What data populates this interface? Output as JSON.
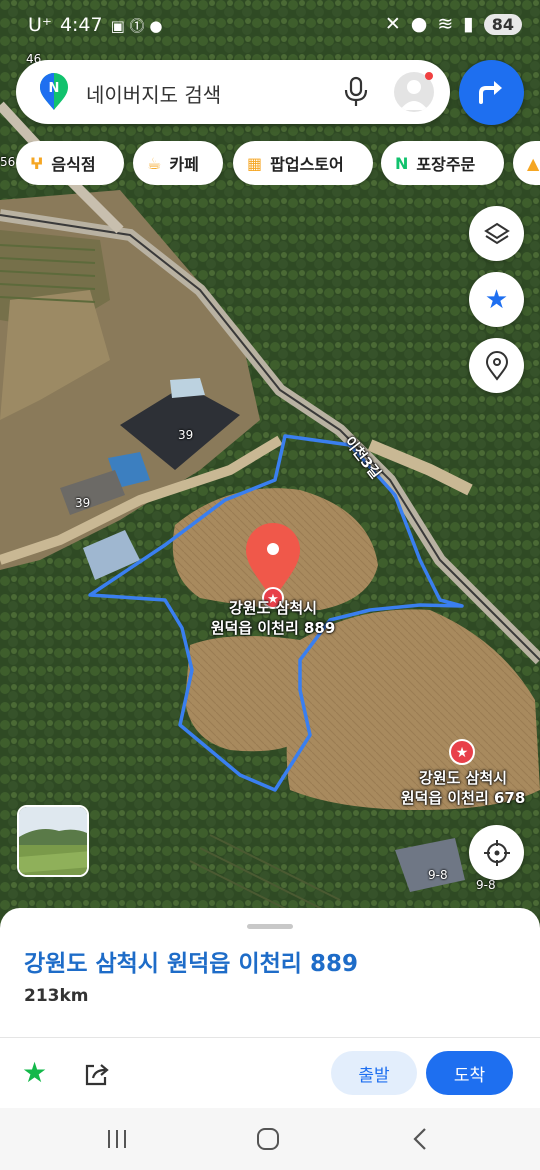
{
  "status_bar": {
    "carrier": "U⁺",
    "time": "4:47",
    "battery": "84"
  },
  "search": {
    "placeholder": "네이버지도 검색"
  },
  "chips": [
    {
      "label": "음식점",
      "icon": "fork-icon"
    },
    {
      "label": "카페",
      "icon": "cup-icon"
    },
    {
      "label": "팝업스토어",
      "icon": "store-icon"
    },
    {
      "label": "포장주문",
      "icon": "naver-n-icon"
    }
  ],
  "map": {
    "road_label": "이천3길",
    "pin_label_line1": "강원도 삼척시",
    "pin_label_line2": "원덕읍 이천리 889",
    "poi_label_line1": "강원도 삼척시",
    "poi_label_line2": "원덕읍 이천리 678",
    "address_numbers": [
      "46",
      "56",
      "39",
      "39",
      "9-8",
      "9-8"
    ]
  },
  "sheet": {
    "title": "강원도 삼척시 원덕읍 이천리 889",
    "distance": "213km",
    "departure_label": "출발",
    "arrival_label": "도착"
  },
  "colors": {
    "accent": "#1e6ff0",
    "pin": "#f0584a",
    "boundary": "#3a7ff0"
  }
}
